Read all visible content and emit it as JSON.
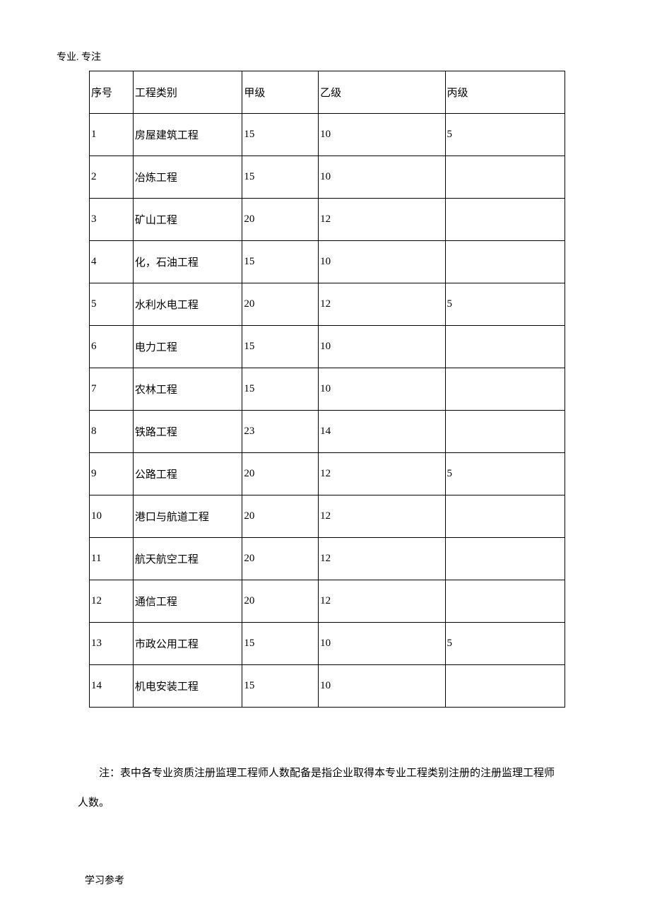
{
  "header": "专业. 专注",
  "chart_data": {
    "type": "table",
    "headers": {
      "index": "序号",
      "category": "工程类别",
      "level_a": "甲级",
      "level_b": "乙级",
      "level_c": "丙级"
    },
    "rows": [
      {
        "index": "1",
        "category": "房屋建筑工程",
        "level_a": "15",
        "level_b": "10",
        "level_c": "5"
      },
      {
        "index": "2",
        "category": "冶炼工程",
        "level_a": "15",
        "level_b": "10",
        "level_c": ""
      },
      {
        "index": "3",
        "category": "矿山工程",
        "level_a": "20",
        "level_b": "12",
        "level_c": ""
      },
      {
        "index": "4",
        "category": "化，石油工程",
        "level_a": "15",
        "level_b": "10",
        "level_c": ""
      },
      {
        "index": "5",
        "category": "水利水电工程",
        "level_a": "20",
        "level_b": "12",
        "level_c": "5"
      },
      {
        "index": "6",
        "category": "电力工程",
        "level_a": "15",
        "level_b": "10",
        "level_c": ""
      },
      {
        "index": "7",
        "category": "农林工程",
        "level_a": "15",
        "level_b": "10",
        "level_c": ""
      },
      {
        "index": "8",
        "category": "铁路工程",
        "level_a": "23",
        "level_b": "14",
        "level_c": ""
      },
      {
        "index": "9",
        "category": "公路工程",
        "level_a": "20",
        "level_b": "12",
        "level_c": "5"
      },
      {
        "index": "10",
        "category": "港口与航道工程",
        "level_a": "20",
        "level_b": "12",
        "level_c": ""
      },
      {
        "index": "11",
        "category": "航天航空工程",
        "level_a": "20",
        "level_b": "12",
        "level_c": ""
      },
      {
        "index": "12",
        "category": "通信工程",
        "level_a": "20",
        "level_b": "12",
        "level_c": ""
      },
      {
        "index": "13",
        "category": "市政公用工程",
        "level_a": "15",
        "level_b": "10",
        "level_c": "5"
      },
      {
        "index": "14",
        "category": "机电安装工程",
        "level_a": "15",
        "level_b": "10",
        "level_c": ""
      }
    ]
  },
  "note": {
    "line1": "注：表中各专业资质注册监理工程师人数配备是指企业取得本专业工程类别注册的注册监理工程师",
    "line2": "人数。"
  },
  "footer": "学习参考"
}
